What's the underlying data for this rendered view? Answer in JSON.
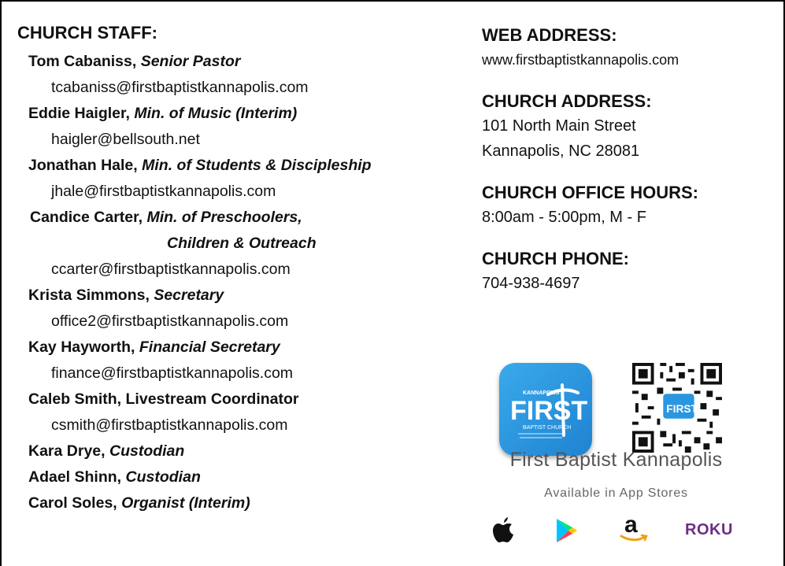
{
  "staff": {
    "heading": "CHURCH STAFF:",
    "members": [
      {
        "name": "Tom Cabaniss,",
        "role": "Senior Pastor",
        "email": "tcabaniss@firstbaptistkannapolis.com"
      },
      {
        "name": "Eddie Haigler,",
        "role": "Min. of Music (Interim)",
        "email": "haigler@bellsouth.net"
      },
      {
        "name": "Jonathan Hale,",
        "role": "Min. of Students & Discipleship",
        "email": "jhale@firstbaptistkannapolis.com"
      },
      {
        "name": "Candice Carter,",
        "role": "Min. of Preschoolers,",
        "role_cont": "Children & Outreach",
        "email": "ccarter@firstbaptistkannapolis.com"
      },
      {
        "name": "Krista Simmons,",
        "role": "Secretary",
        "email": "office2@firstbaptistkannapolis.com"
      },
      {
        "name": "Kay Hayworth,",
        "role": "Financial Secretary",
        "email": "finance@firstbaptistkannapolis.com"
      },
      {
        "name": "Caleb Smith, Livestream Coordinator",
        "role": "",
        "email": "csmith@firstbaptistkannapolis.com"
      },
      {
        "name": "Kara Drye,",
        "role": "Custodian"
      },
      {
        "name": "Adael Shinn,",
        "role": "Custodian"
      },
      {
        "name": "Carol Soles,",
        "role": "Organist (Interim)"
      }
    ]
  },
  "info": {
    "web_heading": "WEB ADDRESS:",
    "web_value": "www.firstbaptistkannapolis.com",
    "address_heading": "CHURCH ADDRESS:",
    "address_line1": "101 North Main Street",
    "address_line2": "Kannapolis, NC 28081",
    "hours_heading": "CHURCH OFFICE HOURS:",
    "hours_value": "8:00am - 5:00pm, M - F",
    "phone_heading": "CHURCH PHONE:",
    "phone_value": "704-938-4697"
  },
  "app": {
    "icon_top_text": "KANNAPOLIS",
    "icon_main_text": "FIRST",
    "icon_sub_text": "BAPTIST CHURCH",
    "qr_badge_text": "FIRST",
    "title": "First Baptist Kannapolis",
    "subtitle": "Available in App Stores",
    "stores": [
      "apple-icon",
      "google-play-icon",
      "amazon-icon",
      "roku-logo"
    ],
    "roku_label": "ROKU",
    "amazon_label": "a",
    "colors": {
      "icon_blue": "#2a96df",
      "roku_purple": "#6c2c86"
    }
  }
}
